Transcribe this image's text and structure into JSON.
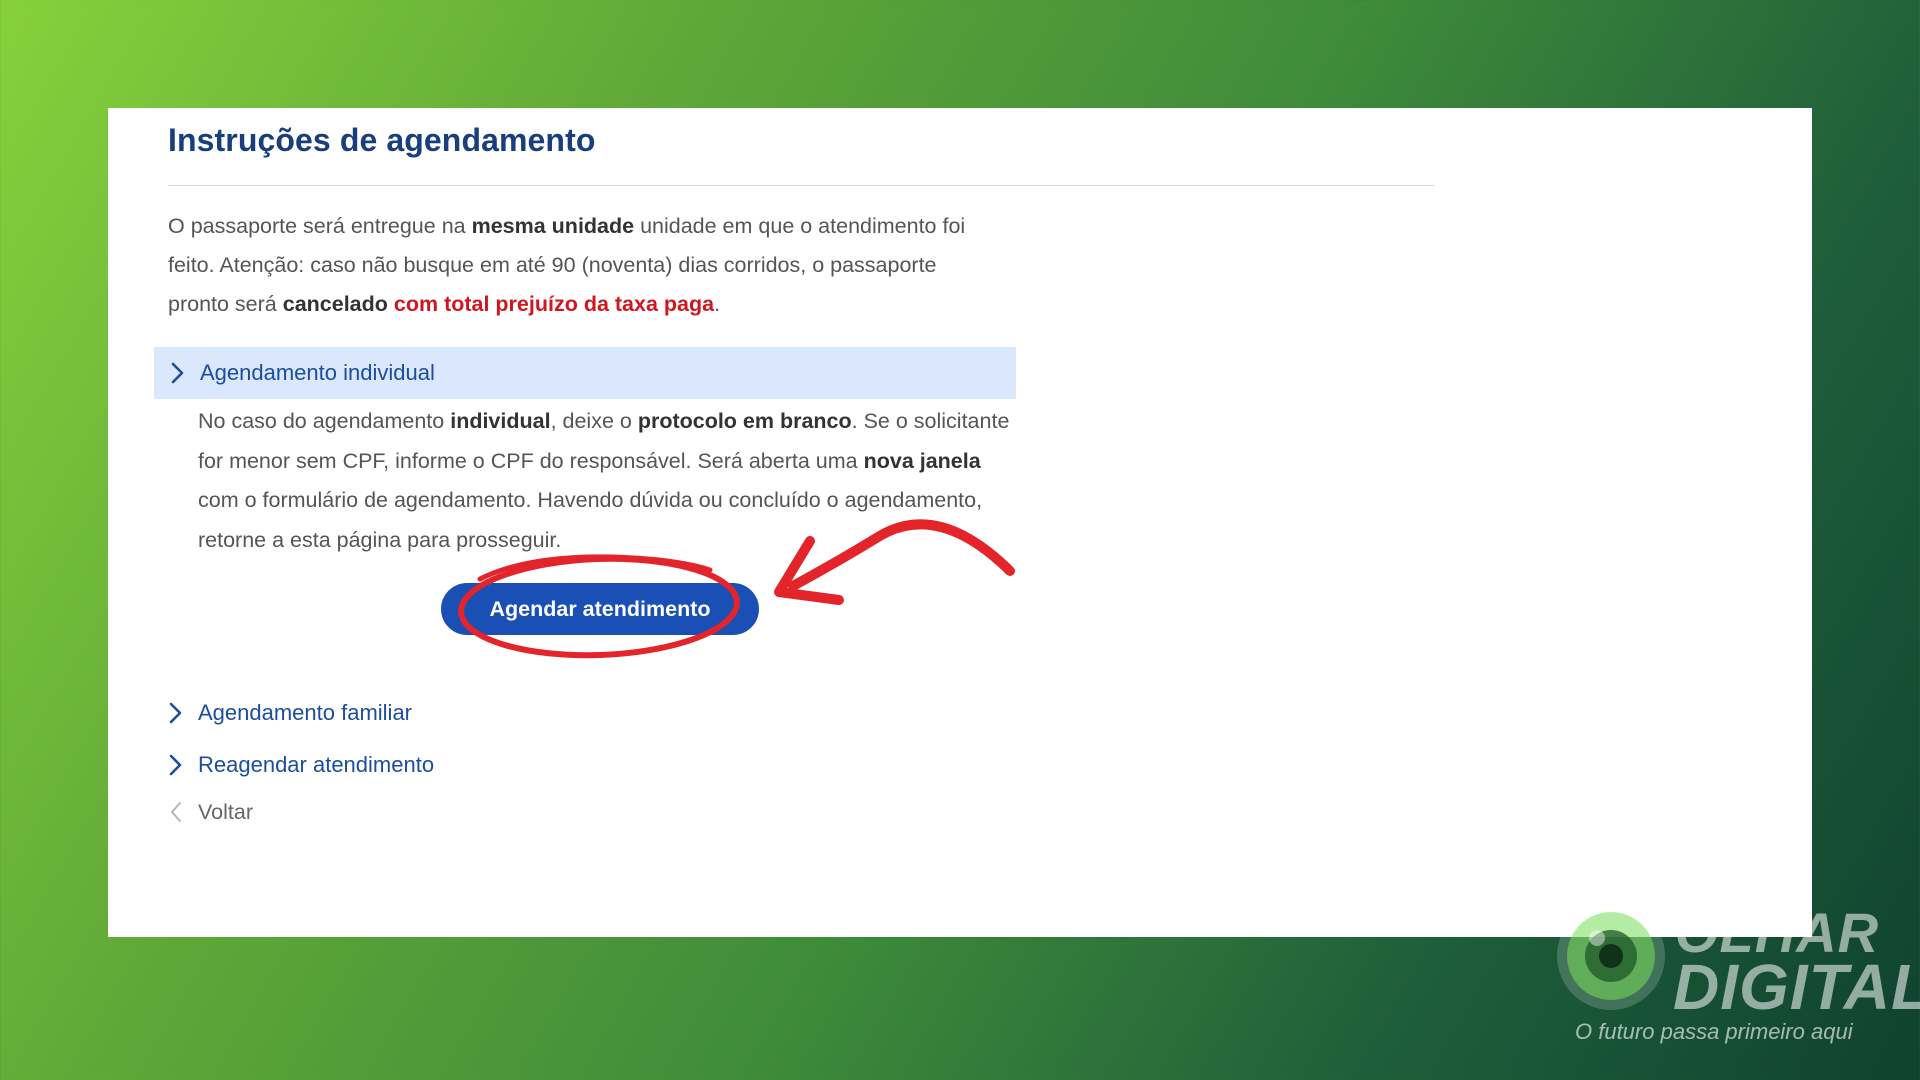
{
  "page": {
    "title": "Instruções de agendamento"
  },
  "intro": {
    "p1": "O passaporte será entregue na ",
    "b1": "mesma unidade",
    "p2": " unidade em que o atendimento foi feito. Atenção: caso não busque em até 90 (noventa) dias corridos, o passaporte pronto será ",
    "b2": "cancelado",
    "p3": " ",
    "warn": "com total prejuízo da taxa paga",
    "p4": "."
  },
  "accordion": {
    "individual": {
      "label": "Agendamento individual",
      "t1": "No caso do agendamento ",
      "b1": "individual",
      "t2": ", deixe o ",
      "b2": "protocolo em branco",
      "t3": ". Se o solicitante for menor sem CPF, informe o CPF do responsável. Será aberta uma ",
      "b3": "nova janela",
      "t4": " com o formulário de agendamento. Havendo dúvida ou concluído o agendamento, retorne a esta página para prosseguir.",
      "button_label": "Agendar atendimento"
    },
    "familiar": {
      "label": "Agendamento familiar"
    },
    "reagendar": {
      "label": "Reagendar atendimento"
    }
  },
  "back": {
    "label": "Voltar"
  },
  "watermark": {
    "word1": "OLHAR",
    "word2": "DIGITAL",
    "tagline": "O futuro passa primeiro aqui"
  },
  "colors": {
    "title": "#183f7c",
    "link": "#1b4ea0",
    "accordion_active_bg": "#dbe7fd",
    "button": "#1a4fb5",
    "warning": "#d0171f",
    "annotation": "#e3242b"
  },
  "icons": {
    "accordion": "chevron-right-icon",
    "back": "chevron-left-icon"
  }
}
